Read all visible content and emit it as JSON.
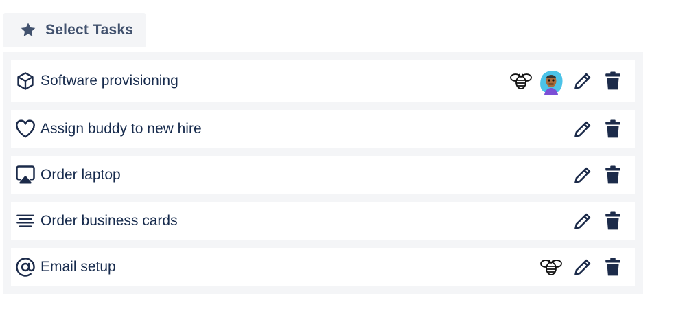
{
  "header": {
    "select_button_label": "Select Tasks",
    "select_button_icon": "star-icon"
  },
  "tasks": [
    {
      "label": "Software provisioning",
      "icon": "cube-icon",
      "badges": [
        "bee-icon",
        "avatar"
      ]
    },
    {
      "label": "Assign buddy to new hire",
      "icon": "heart-icon",
      "badges": []
    },
    {
      "label": "Order laptop",
      "icon": "screen-cast-icon",
      "badges": []
    },
    {
      "label": "Order business cards",
      "icon": "align-center-icon",
      "badges": []
    },
    {
      "label": "Email setup",
      "icon": "at-sign-icon",
      "badges": [
        "bee-icon"
      ]
    }
  ],
  "actions": {
    "edit_icon": "pencil-icon",
    "delete_icon": "trash-icon"
  },
  "colors": {
    "text": "#172b4d",
    "icon": "#1c2b4a",
    "panel_bg": "#f4f5f7",
    "row_bg": "#ffffff",
    "button_text": "#42526e"
  }
}
